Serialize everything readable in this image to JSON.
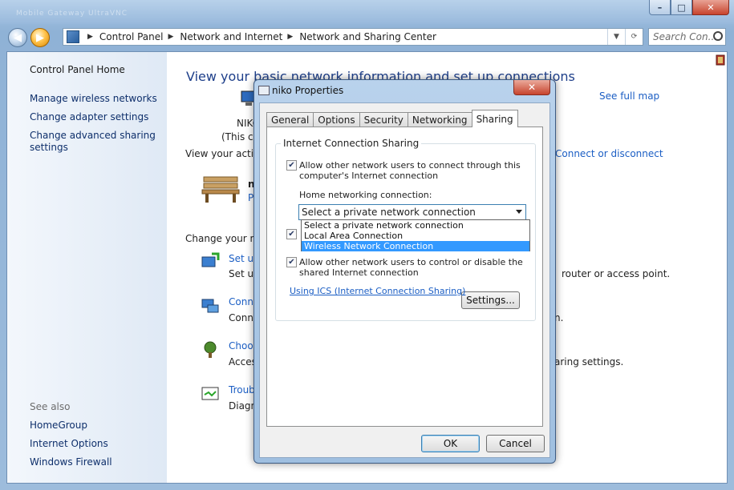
{
  "window": {
    "controls": {
      "minimize": "–",
      "maximize": "□",
      "close": "✕"
    }
  },
  "nav": {
    "back_icon": "◀",
    "forward_icon": "▶"
  },
  "address": {
    "crumbs": [
      "Control Panel",
      "Network and Internet",
      "Network and Sharing Center"
    ],
    "separator": "▶",
    "dropdown_icon": "▼",
    "refresh_icon": "⟳"
  },
  "search": {
    "placeholder": "Search Con..."
  },
  "sidebar": {
    "home": "Control Panel Home",
    "links": [
      "Manage wireless networks",
      "Change adapter settings",
      "Change advanced sharing",
      "settings"
    ],
    "see_also_title": "See also",
    "see_also": [
      "HomeGroup",
      "Internet Options",
      "Windows Firewall"
    ]
  },
  "main": {
    "heading": "View your basic network information and set up connections",
    "see_full_map": "See full map",
    "computer_name": "NIKO",
    "computer_sub": "(This c",
    "active_networks_label": "View your active",
    "connect_disconnect": "Connect or disconnect",
    "network_name": "n",
    "network_type": "P",
    "change_settings_label": "Change your ne",
    "tasks": [
      {
        "title": "Set up",
        "desc": "Set up",
        "desc_tail": "router or access point."
      },
      {
        "title": "Conne",
        "desc": "Conne",
        "desc_tail": "n."
      },
      {
        "title": "Choos",
        "desc": "Acces",
        "desc_tail": "aring settings."
      },
      {
        "title": "Troub",
        "desc": "Diagn",
        "desc_tail": ""
      }
    ]
  },
  "dialog": {
    "title": "niko Properties",
    "close": "✕",
    "tabs": [
      "General",
      "Options",
      "Security",
      "Networking",
      "Sharing"
    ],
    "active_tab": "Sharing",
    "group_label": "Internet Connection Sharing",
    "allow_connect_line1": "Allow other network users to connect through this",
    "allow_connect_line2": "computer's Internet connection",
    "check_mark": "✔",
    "home_network_label": "Home networking connection:",
    "select_value": "Select a private network connection",
    "dropdown_options": [
      "Select a private network connection",
      "Local Area Connection",
      "Wireless Network Connection"
    ],
    "selected_option": "Wireless Network Connection",
    "allow_control_line1": "Allow other network users to control or disable the",
    "allow_control_line2": "shared Internet connection",
    "ics_link": "Using ICS (Internet Connection Sharing)",
    "settings_button": "Settings...",
    "ok_button": "OK",
    "cancel_button": "Cancel"
  },
  "ghost_taskbar": "Mobile   Gateway   UltraVNC"
}
